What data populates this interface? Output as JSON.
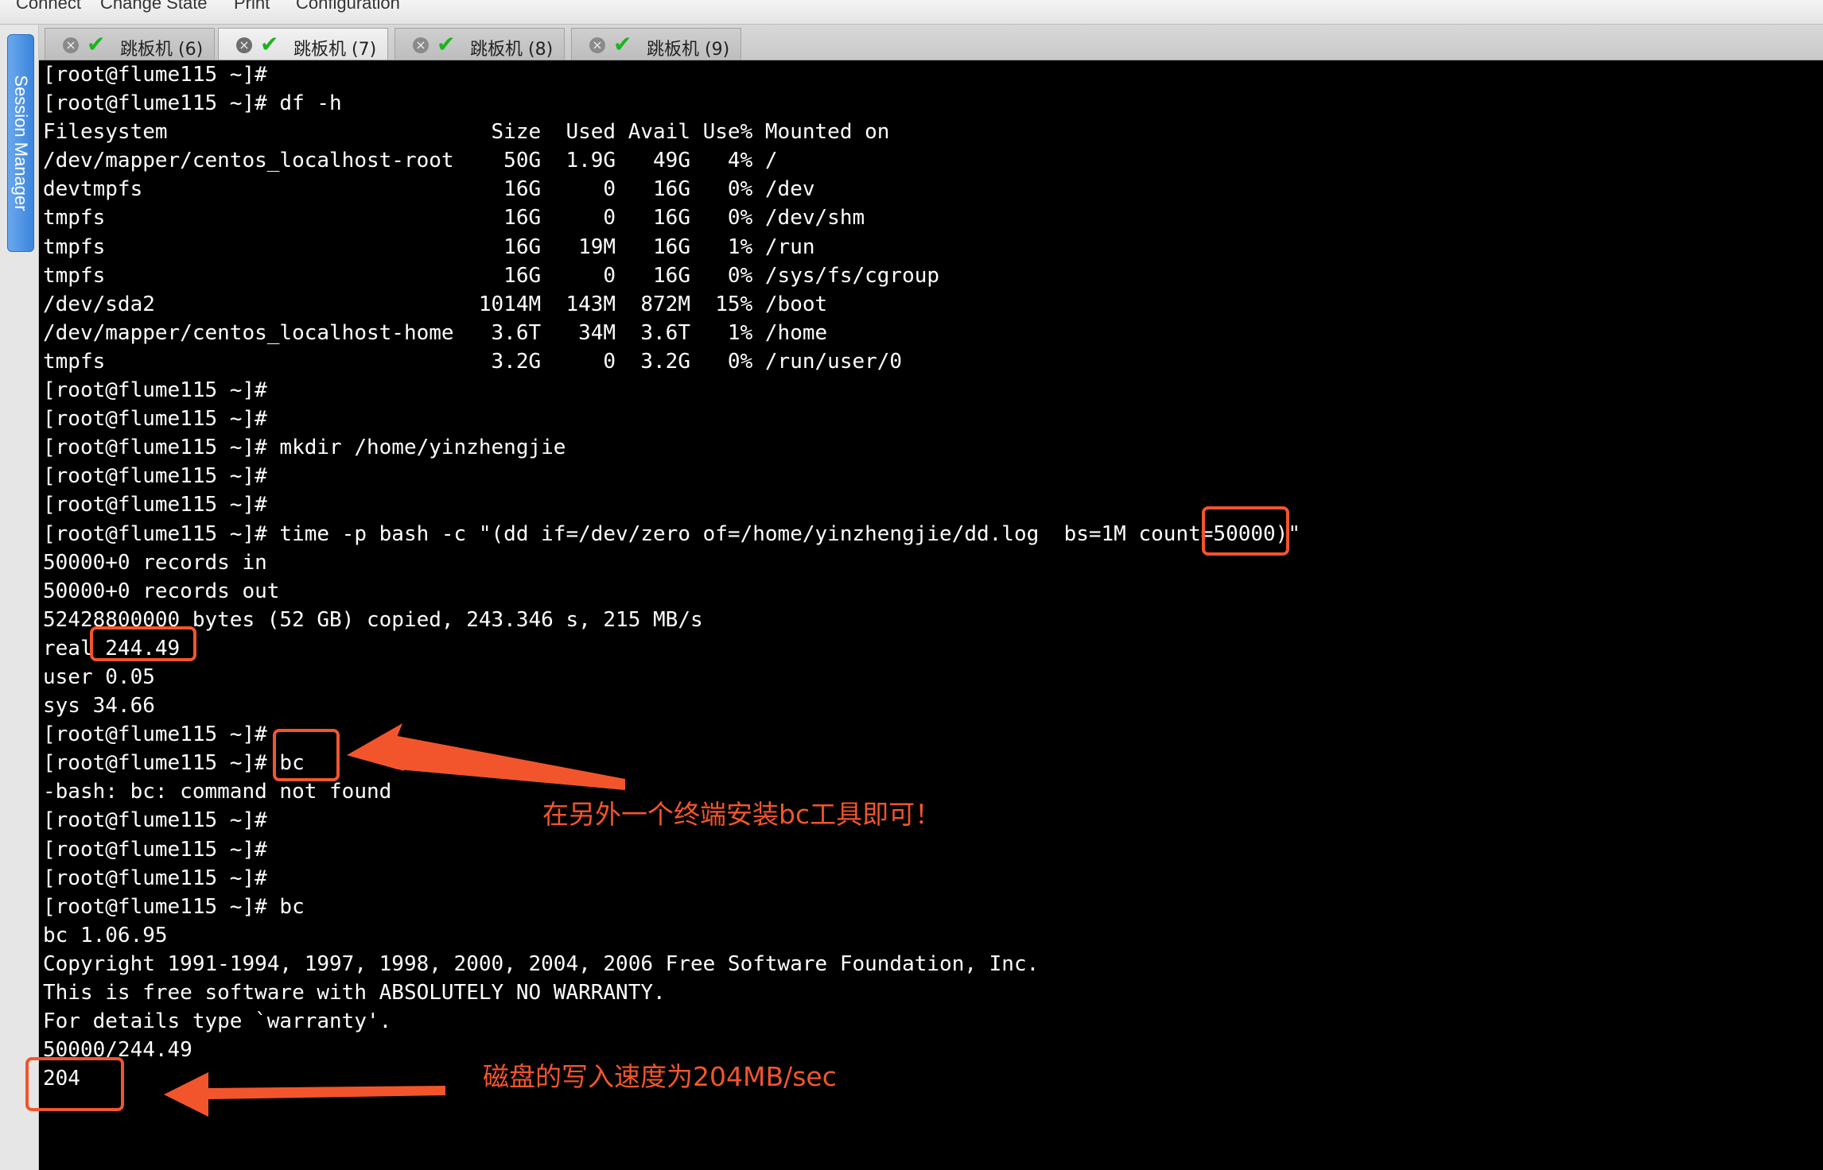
{
  "menubar": {
    "items": [
      "Connect",
      "Change State",
      "Print",
      "Configuration"
    ]
  },
  "sidebar": {
    "session_manager_label": "Session Manager"
  },
  "tabs": [
    {
      "label": "跳板机 (6)",
      "active": false,
      "connected": true
    },
    {
      "label": "跳板机 (7)",
      "active": true,
      "connected": true
    },
    {
      "label": "跳板机 (8)",
      "active": false,
      "connected": true
    },
    {
      "label": "跳板机 (9)",
      "active": false,
      "connected": true
    }
  ],
  "terminal": {
    "lines": [
      "[root@flume115 ~]#",
      "[root@flume115 ~]# df -h",
      "Filesystem                          Size  Used Avail Use% Mounted on",
      "/dev/mapper/centos_localhost-root    50G  1.9G   49G   4% /",
      "devtmpfs                             16G     0   16G   0% /dev",
      "tmpfs                                16G     0   16G   0% /dev/shm",
      "tmpfs                                16G   19M   16G   1% /run",
      "tmpfs                                16G     0   16G   0% /sys/fs/cgroup",
      "/dev/sda2                          1014M  143M  872M  15% /boot",
      "/dev/mapper/centos_localhost-home   3.6T   34M  3.6T   1% /home",
      "tmpfs                               3.2G     0  3.2G   0% /run/user/0",
      "[root@flume115 ~]#",
      "[root@flume115 ~]#",
      "[root@flume115 ~]# mkdir /home/yinzhengjie",
      "[root@flume115 ~]#",
      "[root@flume115 ~]#",
      "[root@flume115 ~]# time -p bash -c \"(dd if=/dev/zero of=/home/yinzhengjie/dd.log  bs=1M count=50000)\"",
      "50000+0 records in",
      "50000+0 records out",
      "52428800000 bytes (52 GB) copied, 243.346 s, 215 MB/s",
      "real 244.49",
      "user 0.05",
      "sys 34.66",
      "[root@flume115 ~]#",
      "[root@flume115 ~]# bc",
      "-bash: bc: command not found",
      "[root@flume115 ~]#",
      "[root@flume115 ~]#",
      "[root@flume115 ~]#",
      "[root@flume115 ~]# bc",
      "bc 1.06.95",
      "Copyright 1991-1994, 1997, 1998, 2000, 2004, 2006 Free Software Foundation, Inc.",
      "This is free software with ABSOLUTELY NO WARRANTY.",
      "For details type `warranty'.",
      "50000/244.49",
      "204"
    ]
  },
  "annotations": {
    "install_bc_note": "在另外一个终端安装bc工具即可！",
    "write_speed_note": "磁盘的写入速度为204MB/sec",
    "color": "#f2552c"
  },
  "colors": {
    "terminal_bg": "#000000",
    "terminal_fg": "#ffffff",
    "connected_check": "#19b51c",
    "session_tab": "#3b85db"
  }
}
